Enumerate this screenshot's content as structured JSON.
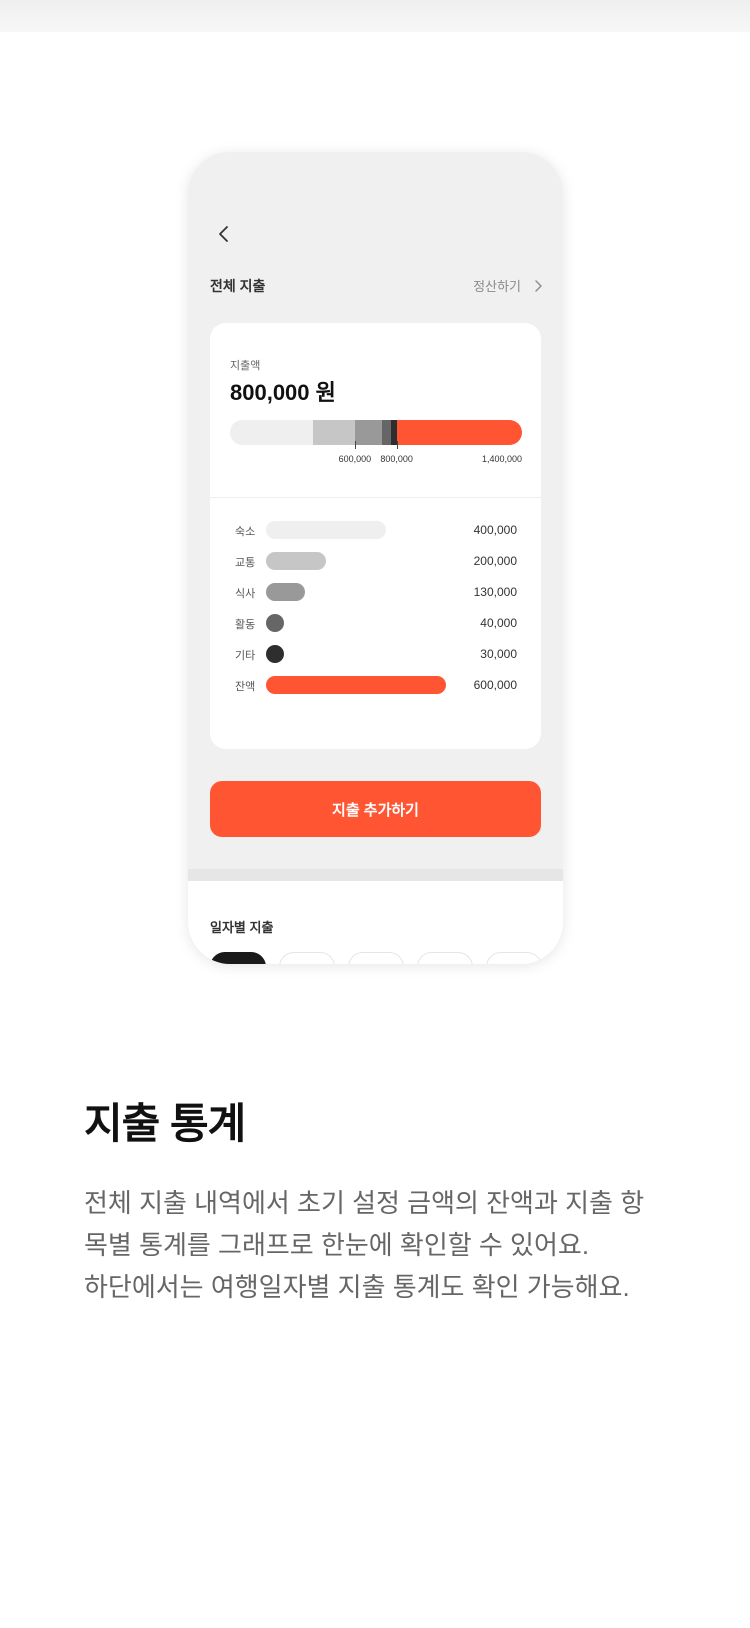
{
  "phone": {
    "back_icon": "chevron-left-icon",
    "header": {
      "title": "전체 지출",
      "settle_label": "정산하기",
      "settle_icon": "chevron-right-icon"
    },
    "summary": {
      "amount_label": "지출액",
      "amount_value": "800,000 원",
      "bar_max": 1400000,
      "bar_segments": [
        {
          "name": "숙소",
          "value": 400000,
          "color": "#efefef"
        },
        {
          "name": "교통",
          "value": 200000,
          "color": "#c6c6c6"
        },
        {
          "name": "식사",
          "value": 130000,
          "color": "#999999"
        },
        {
          "name": "활동",
          "value": 40000,
          "color": "#666666"
        },
        {
          "name": "기타",
          "value": 30000,
          "color": "#2e2e2e"
        },
        {
          "name": "잔액",
          "value": 600000,
          "color": "#ff5533"
        }
      ],
      "ticks": [
        {
          "label": "600,000",
          "value": 600000
        },
        {
          "label": "800,000",
          "value": 800000
        },
        {
          "label": "1,400,000",
          "value": 1400000
        }
      ]
    },
    "categories": [
      {
        "name": "숙소",
        "amount": "400,000",
        "value": 400000,
        "color": "#efefef"
      },
      {
        "name": "교통",
        "amount": "200,000",
        "value": 200000,
        "color": "#c6c6c6"
      },
      {
        "name": "식사",
        "amount": "130,000",
        "value": 130000,
        "color": "#999999"
      },
      {
        "name": "활동",
        "amount": "40,000",
        "value": 40000,
        "color": "#666666"
      },
      {
        "name": "기타",
        "amount": "30,000",
        "value": 30000,
        "color": "#2e2e2e"
      },
      {
        "name": "잔액",
        "amount": "600,000",
        "value": 600000,
        "color": "#ff5533"
      }
    ],
    "add_button_label": "지출 추가하기",
    "daily_title": "일자별 지출"
  },
  "feature": {
    "title": "지출 통계",
    "description_lines": [
      "전체 지출 내역에서 초기 설정 금액의 잔액과 지출 항",
      "목별 통계를 그래프로 한눈에 확인할 수 있어요.",
      "하단에서는 여행일자별 지출 통계도 확인 가능해요."
    ]
  },
  "colors": {
    "accent": "#ff5533",
    "phone_bg": "#f0f0f0"
  }
}
